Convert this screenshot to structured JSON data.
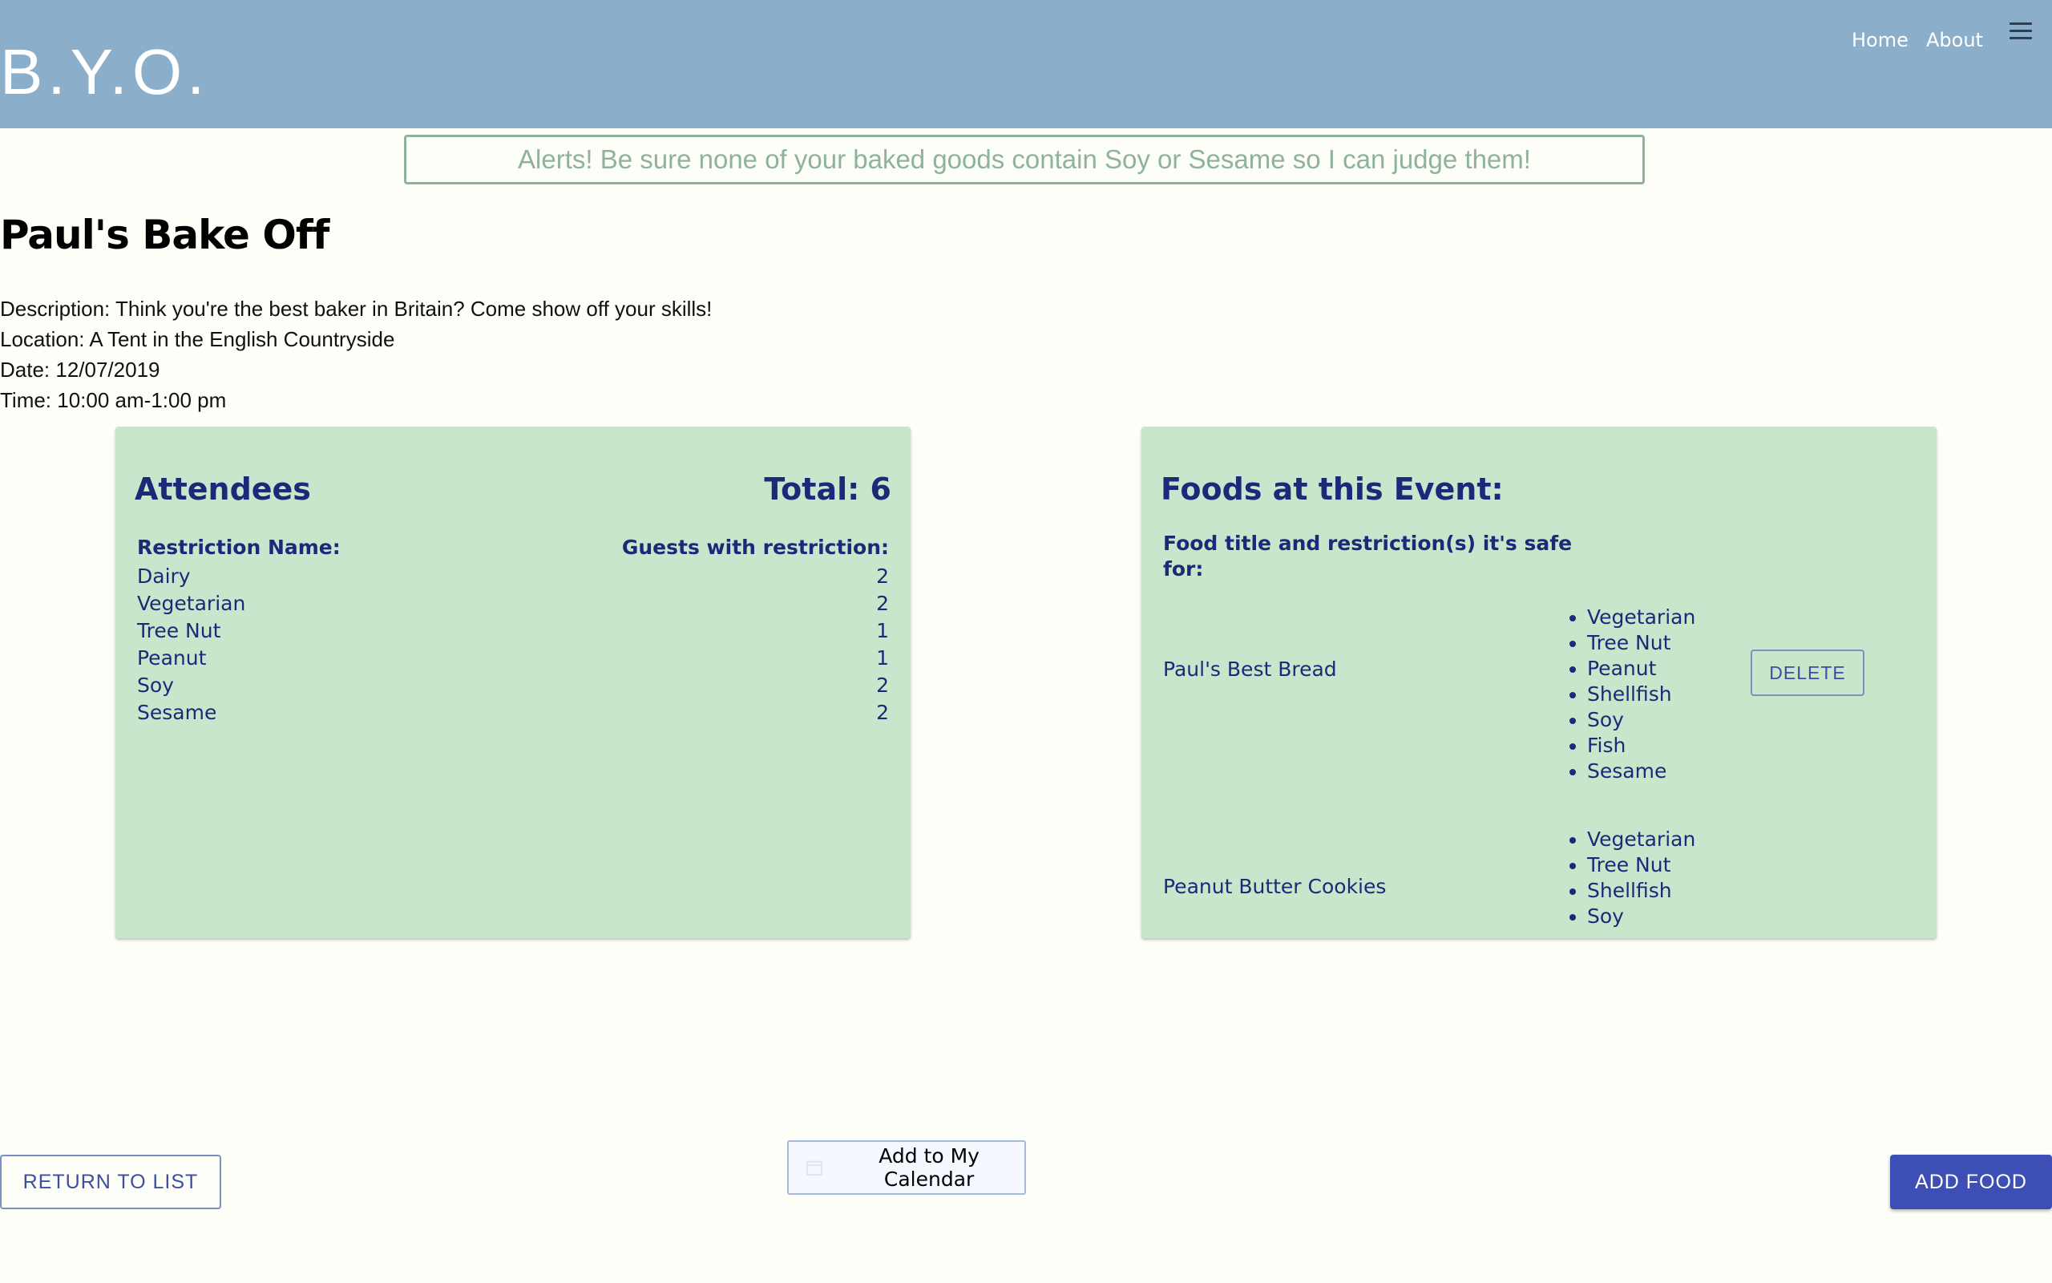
{
  "header": {
    "logo": "B.Y.O.",
    "nav": {
      "home": "Home",
      "about": "About"
    },
    "menu_icon": "hamburger-menu-icon"
  },
  "alert": "Alerts! Be sure none of your baked goods contain Soy or Sesame so I can judge them!",
  "event": {
    "title": "Paul's Bake Off",
    "description": "Description: Think you're the best baker in Britain? Come show off your skills!",
    "location": "Location: A Tent in the English Countryside",
    "date": "Date: 12/07/2019",
    "time": "Time: 10:00 am-1:00 pm"
  },
  "attendees": {
    "title": "Attendees",
    "total": "Total: 6",
    "col_restriction": "Restriction Name:",
    "col_guests": "Guests with restriction:",
    "rows": [
      {
        "name": "Dairy",
        "count": "2"
      },
      {
        "name": "Vegetarian",
        "count": "2"
      },
      {
        "name": "Tree Nut",
        "count": "1"
      },
      {
        "name": "Peanut",
        "count": "1"
      },
      {
        "name": "Soy",
        "count": "2"
      },
      {
        "name": "Sesame",
        "count": "2"
      }
    ]
  },
  "foods": {
    "title": "Foods at this Event:",
    "header": "Food title and restriction(s) it's safe for:",
    "delete_label": "DELETE",
    "items": [
      {
        "name": "Paul's Best Bread",
        "restrictions": [
          "Vegetarian",
          "Tree Nut",
          "Peanut",
          "Shellfish",
          "Soy",
          "Fish",
          "Sesame"
        ]
      },
      {
        "name": "Peanut Butter Cookies",
        "restrictions": [
          "Vegetarian",
          "Tree Nut",
          "Shellfish",
          "Soy"
        ]
      }
    ]
  },
  "buttons": {
    "return": "RETURN TO LIST",
    "calendar": "Add to My Calendar",
    "add_food": "ADD FOOD"
  },
  "colors": {
    "header_bg": "#8bafca",
    "card_bg": "#c8e6cb",
    "card_text": "#1a2a78",
    "alert": "#8fb29a",
    "primary": "#3d4fb5"
  }
}
